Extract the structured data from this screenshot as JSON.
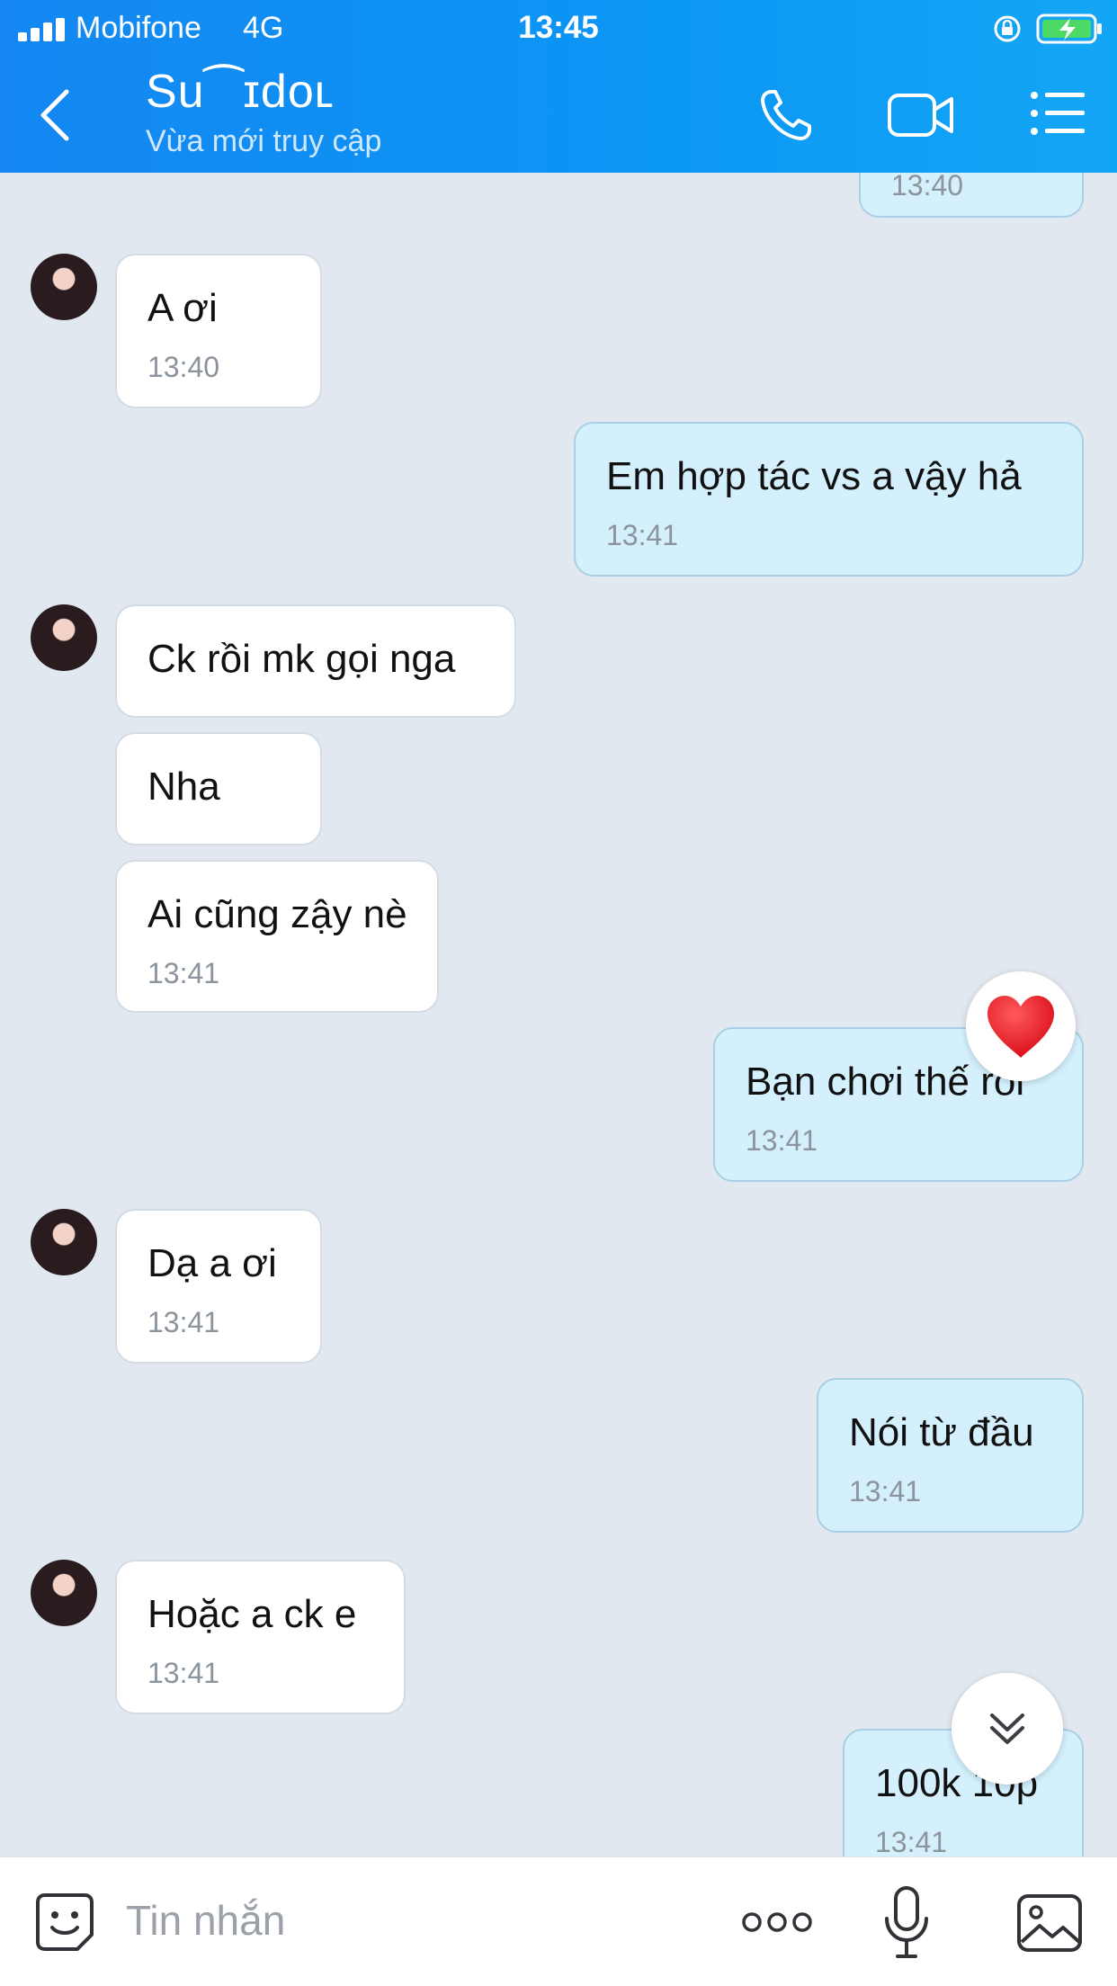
{
  "status_bar": {
    "carrier": "Mobifone",
    "network": "4G",
    "time": "13:45"
  },
  "header": {
    "contact_name": "Su⁀ɪdoʟ",
    "presence": "Vừa mới truy cập"
  },
  "messages": [
    {
      "dir": "out",
      "text": "",
      "time": "13:40"
    },
    {
      "dir": "in",
      "text": "A ơi",
      "time": "13:40"
    },
    {
      "dir": "out",
      "text": "Em hợp tác vs a vậy hả",
      "time": "13:41"
    },
    {
      "dir": "in",
      "text": "Ck rồi mk gọi nga",
      "time": ""
    },
    {
      "dir": "in",
      "text": "Nha",
      "time": ""
    },
    {
      "dir": "in",
      "text": "Ai cũng zậy nè",
      "time": "13:41"
    },
    {
      "dir": "out",
      "text": "Bạn chơi thế rồi",
      "time": "13:41",
      "reaction": "heart"
    },
    {
      "dir": "in",
      "text": "Dạ a ơi",
      "time": "13:41"
    },
    {
      "dir": "out",
      "text": "Nói từ đầu",
      "time": "13:41"
    },
    {
      "dir": "in",
      "text": "Hoặc a ck e",
      "time": "13:41"
    },
    {
      "dir": "out",
      "text": "100k 10p",
      "time": "13:41"
    }
  ],
  "input": {
    "placeholder": "Tin nhắn"
  },
  "colors": {
    "header": "#1487f2",
    "outgoing": "#d4f0fd",
    "incoming": "#ffffff",
    "chat_bg": "#e2e8ef",
    "heart": "#e3101e"
  },
  "icons": [
    "back-icon",
    "call-icon",
    "video-icon",
    "menu-icon",
    "heart-icon",
    "scroll-down-icon",
    "sticker-icon",
    "more-icon",
    "mic-icon",
    "image-icon"
  ]
}
